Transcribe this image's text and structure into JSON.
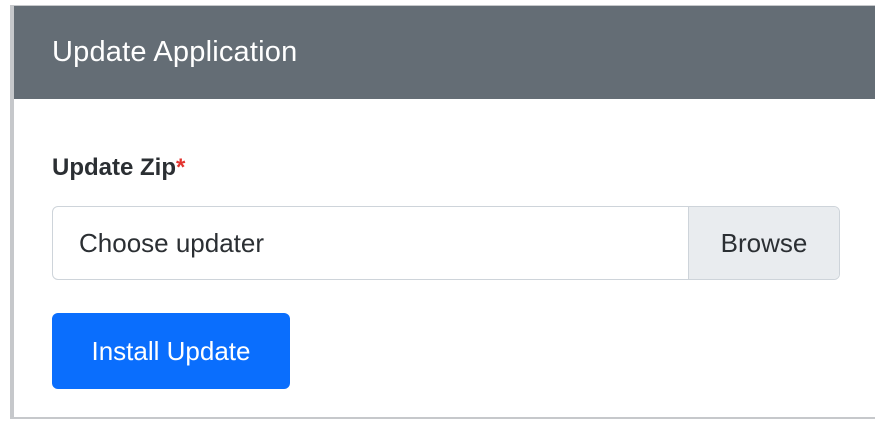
{
  "header": {
    "title": "Update Application"
  },
  "form": {
    "label": "Update Zip",
    "required_mark": "*",
    "file_placeholder": "Choose updater",
    "browse_label": "Browse",
    "install_label": "Install Update"
  },
  "colors": {
    "header_bg": "#646d75",
    "primary": "#0a6efd",
    "required": "#e3342f",
    "browse_bg": "#e9ecef"
  }
}
